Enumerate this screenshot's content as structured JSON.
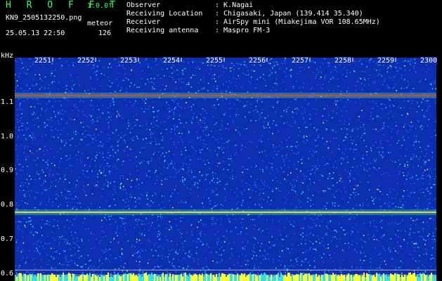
{
  "header": {
    "app_title": "H R O F F T",
    "version": "1.0.0f",
    "filename": "KN9_2505132250.png",
    "mode": "meteor",
    "datetime": "25.05.13 22:50",
    "count": "126"
  },
  "meta": [
    {
      "label": "Observer",
      "value": ": K.Nagai"
    },
    {
      "label": "Receiving Location",
      "value": ": Chigasaki, Japan (139.414 35.340)"
    },
    {
      "label": "Receiver",
      "value": ": AirSpy mini (Miakejima VOR 108.65MHz)"
    },
    {
      "label": "Receiving antenna",
      "value": ": Maspro FM-3"
    }
  ],
  "chart_data": {
    "type": "heatmap",
    "ylabel": "kHz",
    "y_ticks": [
      "1.1",
      "1.0",
      "0.9",
      "0.8",
      "0.7",
      "0.6"
    ],
    "y_tick_values": [
      1.1,
      1.0,
      0.9,
      0.8,
      0.7,
      0.6
    ],
    "ylim": [
      0.58,
      1.23
    ],
    "x_ticks": [
      "2251",
      "2252",
      "2253",
      "2254",
      "2255",
      "2256",
      "2257",
      "2258",
      "2259",
      "2300"
    ],
    "x_tick_values": [
      2251,
      2252,
      2253,
      2254,
      2255,
      2256,
      2257,
      2258,
      2259,
      2300
    ],
    "xlim": [
      2250,
      2300
    ],
    "bands": [
      {
        "freq": 1.12,
        "color": "#ff3030"
      },
      {
        "freq": 0.78,
        "color": "#ffd040"
      }
    ],
    "colors": {
      "background": "#0b2fb0",
      "noise_low": "#2a6cff",
      "noise_mid": "#33ddff",
      "noise_high": "#ffff33"
    }
  }
}
